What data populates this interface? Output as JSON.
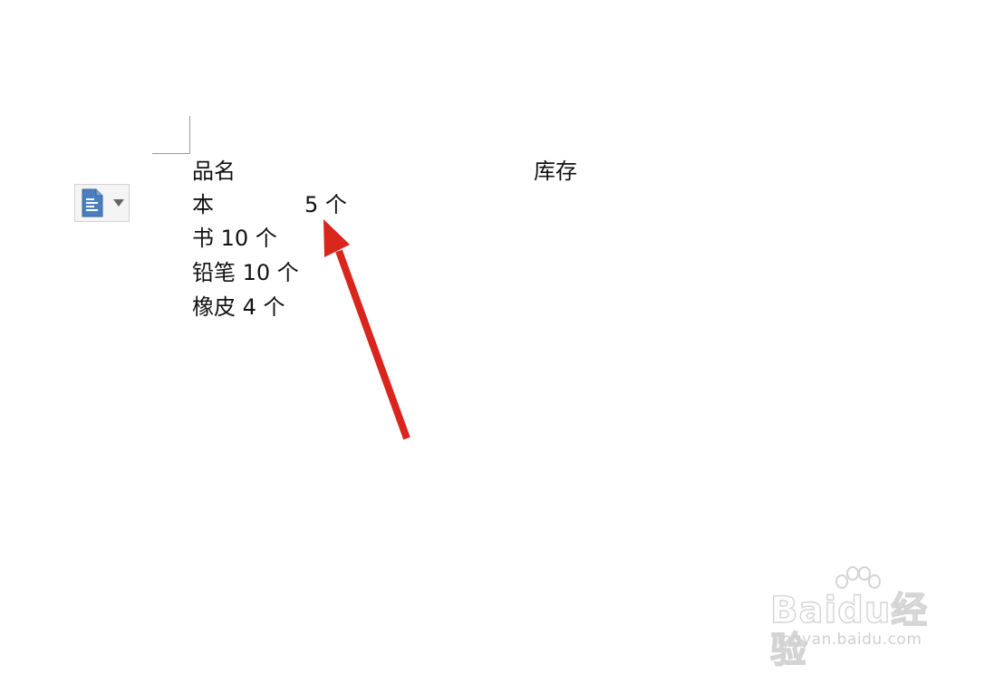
{
  "document": {
    "header": {
      "name_label": "品名",
      "stock_label": "库存"
    },
    "lines": [
      {
        "name": "本",
        "value": "5 个"
      },
      {
        "text": "书 10 个"
      },
      {
        "text": "铅笔 10 个"
      },
      {
        "text": "橡皮 4 个"
      }
    ]
  },
  "paste_options": {
    "icon": "paste-document-icon",
    "dropdown_icon": "triangle-down-icon"
  },
  "annotation": {
    "arrow_color": "#d9251c"
  },
  "watermark": {
    "brand": "Baidu经验",
    "url": "jingyan.baidu.com"
  },
  "colors": {
    "paste_icon": "#4a7ebf",
    "text": "#111111"
  }
}
